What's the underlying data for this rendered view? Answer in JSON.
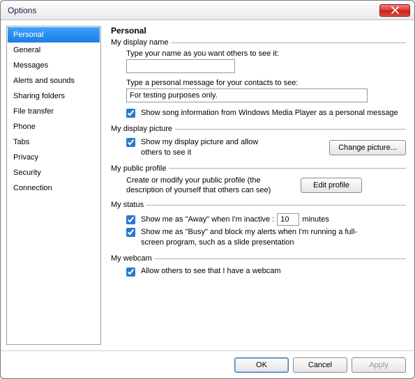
{
  "window": {
    "title": "Options"
  },
  "sidebar": {
    "items": [
      {
        "label": "Personal",
        "selected": true
      },
      {
        "label": "General"
      },
      {
        "label": "Messages"
      },
      {
        "label": "Alerts and sounds"
      },
      {
        "label": "Sharing folders"
      },
      {
        "label": "File transfer"
      },
      {
        "label": "Phone"
      },
      {
        "label": "Tabs"
      },
      {
        "label": "Privacy"
      },
      {
        "label": "Security"
      },
      {
        "label": "Connection"
      }
    ]
  },
  "page": {
    "heading": "Personal",
    "display_name": {
      "legend": "My display name",
      "prompt": "Type your name as you want others to see it:",
      "value": "",
      "msg_prompt": "Type a personal message for your contacts to see:",
      "msg_value": "For testing purposes only.",
      "song_checked": true,
      "song_label": "Show song information from Windows Media Player as a personal message"
    },
    "display_picture": {
      "legend": "My display picture",
      "show_checked": true,
      "show_label": "Show my display picture and allow others to see it",
      "button": "Change picture..."
    },
    "public_profile": {
      "legend": "My public profile",
      "desc": "Create or modify your public profile (the description of yourself that others can see)",
      "button": "Edit profile"
    },
    "status": {
      "legend": "My status",
      "away_checked": true,
      "away_pre": "Show me as \"Away\" when I'm inactive :",
      "away_value": "10",
      "away_post": "minutes",
      "busy_checked": true,
      "busy_label": "Show me as \"Busy\" and block my alerts when I'm running a full-screen program, such as a slide presentation"
    },
    "webcam": {
      "legend": "My webcam",
      "allow_checked": true,
      "allow_label": "Allow others to see that I have a webcam"
    }
  },
  "footer": {
    "ok": "OK",
    "cancel": "Cancel",
    "apply": "Apply"
  }
}
